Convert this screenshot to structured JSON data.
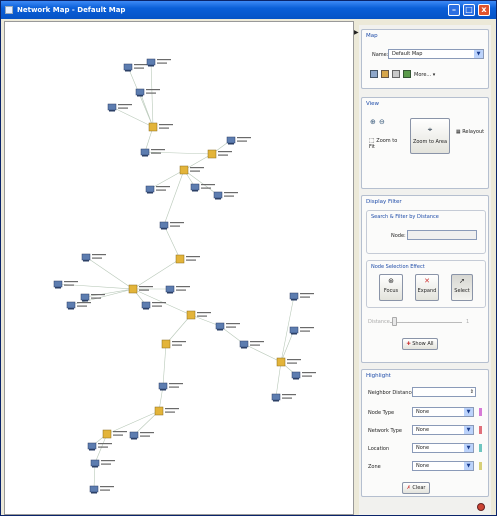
{
  "window": {
    "title": "Network Map - Default Map"
  },
  "map_group": {
    "title": "Map",
    "name_label": "Name:",
    "name_value": "Default Map",
    "more_label": "More..."
  },
  "view_group": {
    "title": "View",
    "zoom_to_fit": "Zoom to Fit",
    "zoom_to_area": "Zoom to Area",
    "relayout": "Relayout"
  },
  "display_filter": {
    "title": "Display Filter",
    "search_title": "Search & Filter by Distance",
    "node_label": "Node:",
    "node_value": "",
    "effect_title": "Node Selection Effect",
    "focus": "Focus",
    "expand": "Expand",
    "select": "Select",
    "distance_label": "Distance",
    "distance_value": "1",
    "show_all": "Show All"
  },
  "highlight": {
    "title": "Highlight",
    "neighbor_distance_label": "Neighbor Distance",
    "neighbor_distance_value": "",
    "rows": [
      {
        "label": "Node Type",
        "value": "None",
        "color": "#d67ad6"
      },
      {
        "label": "Network Type",
        "value": "None",
        "color": "#e0707a"
      },
      {
        "label": "Location",
        "value": "None",
        "color": "#6fc6c0"
      },
      {
        "label": "Zone",
        "value": "None",
        "color": "#d8d078"
      }
    ],
    "clear": "Clear"
  },
  "colors": {
    "accent": "#0a5fd8",
    "group_title": "#1c4aa8"
  }
}
